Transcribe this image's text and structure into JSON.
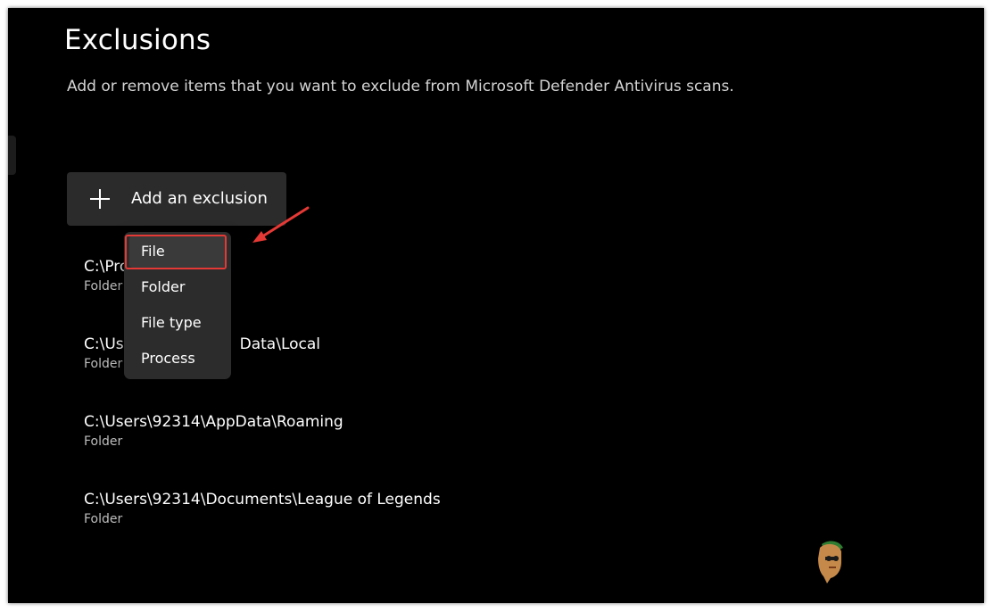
{
  "page": {
    "title": "Exclusions",
    "description": "Add or remove items that you want to exclude from Microsoft Defender Antivirus scans."
  },
  "add_button": {
    "label": "Add an exclusion",
    "icon": "plus-icon"
  },
  "exclusions": [
    {
      "path": "C:\\Pro",
      "type": "Folder"
    },
    {
      "path": "C:\\Us",
      "path_tail": "Data\\Local",
      "type": "Folder"
    },
    {
      "path": "C:\\Users\\92314\\AppData\\Roaming",
      "type": "Folder"
    },
    {
      "path": "C:\\Users\\92314\\Documents\\League of Legends",
      "type": "Folder"
    }
  ],
  "menu": {
    "items": [
      "File",
      "Folder",
      "File type",
      "Process"
    ],
    "selected": "File"
  },
  "colors": {
    "background": "#000000",
    "button": "#2b2b2b",
    "menu": "#2c2c2c",
    "annotation": "#e53935"
  }
}
